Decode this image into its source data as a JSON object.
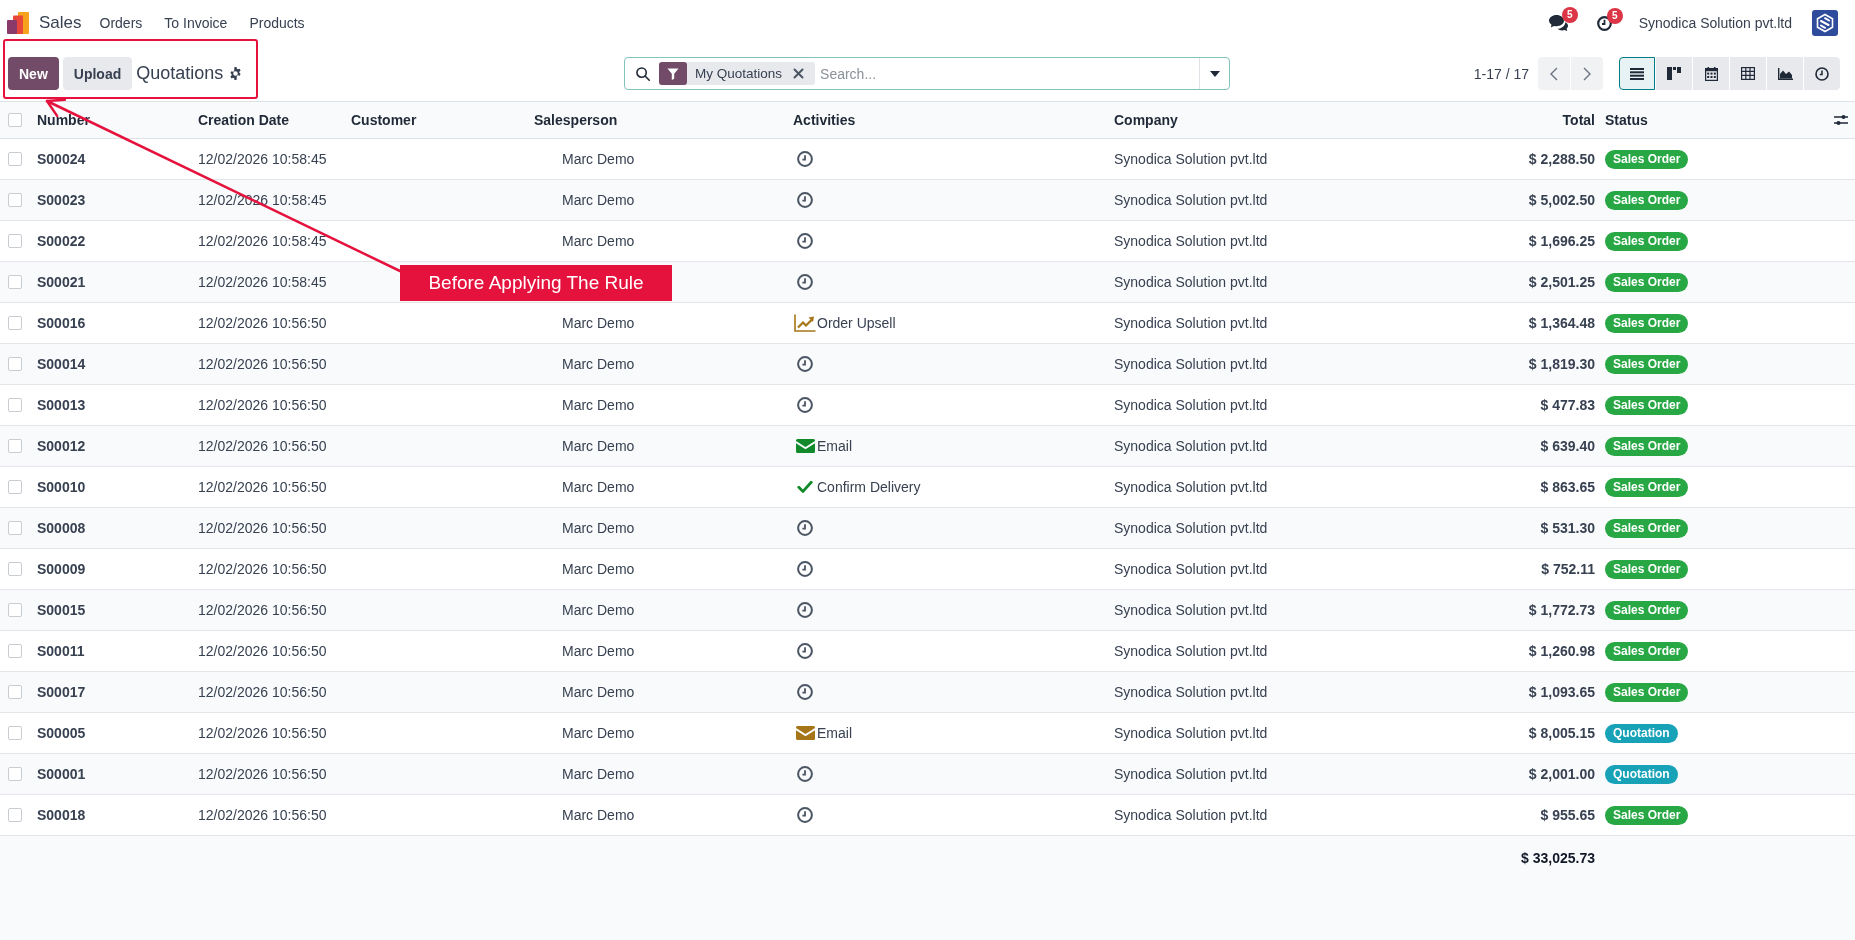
{
  "navbar": {
    "app_name": "Sales",
    "menu": [
      {
        "label": "Orders"
      },
      {
        "label": "To Invoice"
      },
      {
        "label": "Products"
      }
    ],
    "messages_count": "5",
    "activities_count": "5",
    "company": "Synodica Solution pvt.ltd"
  },
  "control_panel": {
    "buttons": [
      {
        "label": "New",
        "kind": "primary"
      },
      {
        "label": "Upload",
        "kind": "secondary"
      }
    ],
    "title": "Quotations",
    "search": {
      "facets": [
        {
          "label": "My Quotations"
        }
      ],
      "placeholder": "Search..."
    },
    "pager": "1-17 / 17",
    "views": [
      {
        "kind": "list",
        "selected": true
      },
      {
        "kind": "kanban",
        "selected": false
      },
      {
        "kind": "calendar",
        "selected": false
      },
      {
        "kind": "pivot",
        "selected": false
      },
      {
        "kind": "graph",
        "selected": false
      },
      {
        "kind": "activity",
        "selected": false
      }
    ]
  },
  "table": {
    "all_selected": false,
    "columns": [
      "Number",
      "Creation Date",
      "Customer",
      "Salesperson",
      "Activities",
      "Company",
      "Total",
      "Status"
    ],
    "rows": [
      {
        "number": "S00024",
        "creation_date": "12/02/2026 10:58:45",
        "salesperson": "Marc Demo",
        "activity": {
          "kind": "schedule"
        },
        "company": "Synodica Solution pvt.ltd",
        "total": "$ 2,288.50",
        "status": {
          "label": "Sales Order",
          "color": "#28a745"
        },
        "selected": false
      },
      {
        "number": "S00023",
        "creation_date": "12/02/2026 10:58:45",
        "salesperson": "Marc Demo",
        "activity": {
          "kind": "schedule"
        },
        "company": "Synodica Solution pvt.ltd",
        "total": "$ 5,002.50",
        "status": {
          "label": "Sales Order",
          "color": "#28a745"
        },
        "selected": false
      },
      {
        "number": "S00022",
        "creation_date": "12/02/2026 10:58:45",
        "salesperson": "Marc Demo",
        "activity": {
          "kind": "schedule"
        },
        "company": "Synodica Solution pvt.ltd",
        "total": "$ 1,696.25",
        "status": {
          "label": "Sales Order",
          "color": "#28a745"
        },
        "selected": false
      },
      {
        "number": "S00021",
        "creation_date": "12/02/2026 10:58:45",
        "activity": {
          "kind": "schedule"
        },
        "company": "Synodica Solution pvt.ltd",
        "total": "$ 2,501.25",
        "status": {
          "label": "Sales Order",
          "color": "#28a745"
        },
        "selected": false
      },
      {
        "number": "S00016",
        "creation_date": "12/02/2026 10:56:50",
        "salesperson": "Marc Demo",
        "activity": {
          "kind": "upsell",
          "label": "Order Upsell",
          "color": "#a57518"
        },
        "company": "Synodica Solution pvt.ltd",
        "total": "$ 1,364.48",
        "status": {
          "label": "Sales Order",
          "color": "#28a745"
        },
        "selected": false
      },
      {
        "number": "S00014",
        "creation_date": "12/02/2026 10:56:50",
        "salesperson": "Marc Demo",
        "activity": {
          "kind": "schedule"
        },
        "company": "Synodica Solution pvt.ltd",
        "total": "$ 1,819.30",
        "status": {
          "label": "Sales Order",
          "color": "#28a745"
        },
        "selected": false
      },
      {
        "number": "S00013",
        "creation_date": "12/02/2026 10:56:50",
        "salesperson": "Marc Demo",
        "activity": {
          "kind": "schedule"
        },
        "company": "Synodica Solution pvt.ltd",
        "total": "$ 477.83",
        "status": {
          "label": "Sales Order",
          "color": "#28a745"
        },
        "selected": false
      },
      {
        "number": "S00012",
        "creation_date": "12/02/2026 10:56:50",
        "salesperson": "Marc Demo",
        "activity": {
          "kind": "email",
          "label": "Email",
          "color": "#12892b"
        },
        "company": "Synodica Solution pvt.ltd",
        "total": "$ 639.40",
        "status": {
          "label": "Sales Order",
          "color": "#28a745"
        },
        "selected": false
      },
      {
        "number": "S00010",
        "creation_date": "12/02/2026 10:56:50",
        "salesperson": "Marc Demo",
        "activity": {
          "kind": "todo",
          "label": "Confirm Delivery",
          "color": "#12892b"
        },
        "company": "Synodica Solution pvt.ltd",
        "total": "$ 863.65",
        "status": {
          "label": "Sales Order",
          "color": "#28a745"
        },
        "selected": false
      },
      {
        "number": "S00008",
        "creation_date": "12/02/2026 10:56:50",
        "salesperson": "Marc Demo",
        "activity": {
          "kind": "schedule"
        },
        "company": "Synodica Solution pvt.ltd",
        "total": "$ 531.30",
        "status": {
          "label": "Sales Order",
          "color": "#28a745"
        },
        "selected": false
      },
      {
        "number": "S00009",
        "creation_date": "12/02/2026 10:56:50",
        "salesperson": "Marc Demo",
        "activity": {
          "kind": "schedule"
        },
        "company": "Synodica Solution pvt.ltd",
        "total": "$ 752.11",
        "status": {
          "label": "Sales Order",
          "color": "#28a745"
        },
        "selected": false
      },
      {
        "number": "S00015",
        "creation_date": "12/02/2026 10:56:50",
        "salesperson": "Marc Demo",
        "activity": {
          "kind": "schedule"
        },
        "company": "Synodica Solution pvt.ltd",
        "total": "$ 1,772.73",
        "status": {
          "label": "Sales Order",
          "color": "#28a745"
        },
        "selected": false
      },
      {
        "number": "S00011",
        "creation_date": "12/02/2026 10:56:50",
        "salesperson": "Marc Demo",
        "activity": {
          "kind": "schedule"
        },
        "company": "Synodica Solution pvt.ltd",
        "total": "$ 1,260.98",
        "status": {
          "label": "Sales Order",
          "color": "#28a745"
        },
        "selected": false
      },
      {
        "number": "S00017",
        "creation_date": "12/02/2026 10:56:50",
        "salesperson": "Marc Demo",
        "activity": {
          "kind": "schedule"
        },
        "company": "Synodica Solution pvt.ltd",
        "total": "$ 1,093.65",
        "status": {
          "label": "Sales Order",
          "color": "#28a745"
        },
        "selected": false
      },
      {
        "number": "S00005",
        "creation_date": "12/02/2026 10:56:50",
        "salesperson": "Marc Demo",
        "activity": {
          "kind": "email",
          "label": "Email",
          "color": "#a57518"
        },
        "company": "Synodica Solution pvt.ltd",
        "total": "$ 8,005.15",
        "status": {
          "label": "Quotation",
          "color": "#17a2b8"
        },
        "selected": false
      },
      {
        "number": "S00001",
        "creation_date": "12/02/2026 10:56:50",
        "salesperson": "Marc Demo",
        "activity": {
          "kind": "schedule"
        },
        "company": "Synodica Solution pvt.ltd",
        "total": "$ 2,001.00",
        "status": {
          "label": "Quotation",
          "color": "#17a2b8"
        },
        "selected": false
      },
      {
        "number": "S00018",
        "creation_date": "12/02/2026 10:56:50",
        "salesperson": "Marc Demo",
        "activity": {
          "kind": "schedule"
        },
        "company": "Synodica Solution pvt.ltd",
        "total": "$ 955.65",
        "status": {
          "label": "Sales Order",
          "color": "#28a745"
        },
        "selected": false
      }
    ],
    "footer": {
      "total": "$ 33,025.73"
    }
  },
  "annotation": {
    "label": "Before Applying The Rule"
  }
}
